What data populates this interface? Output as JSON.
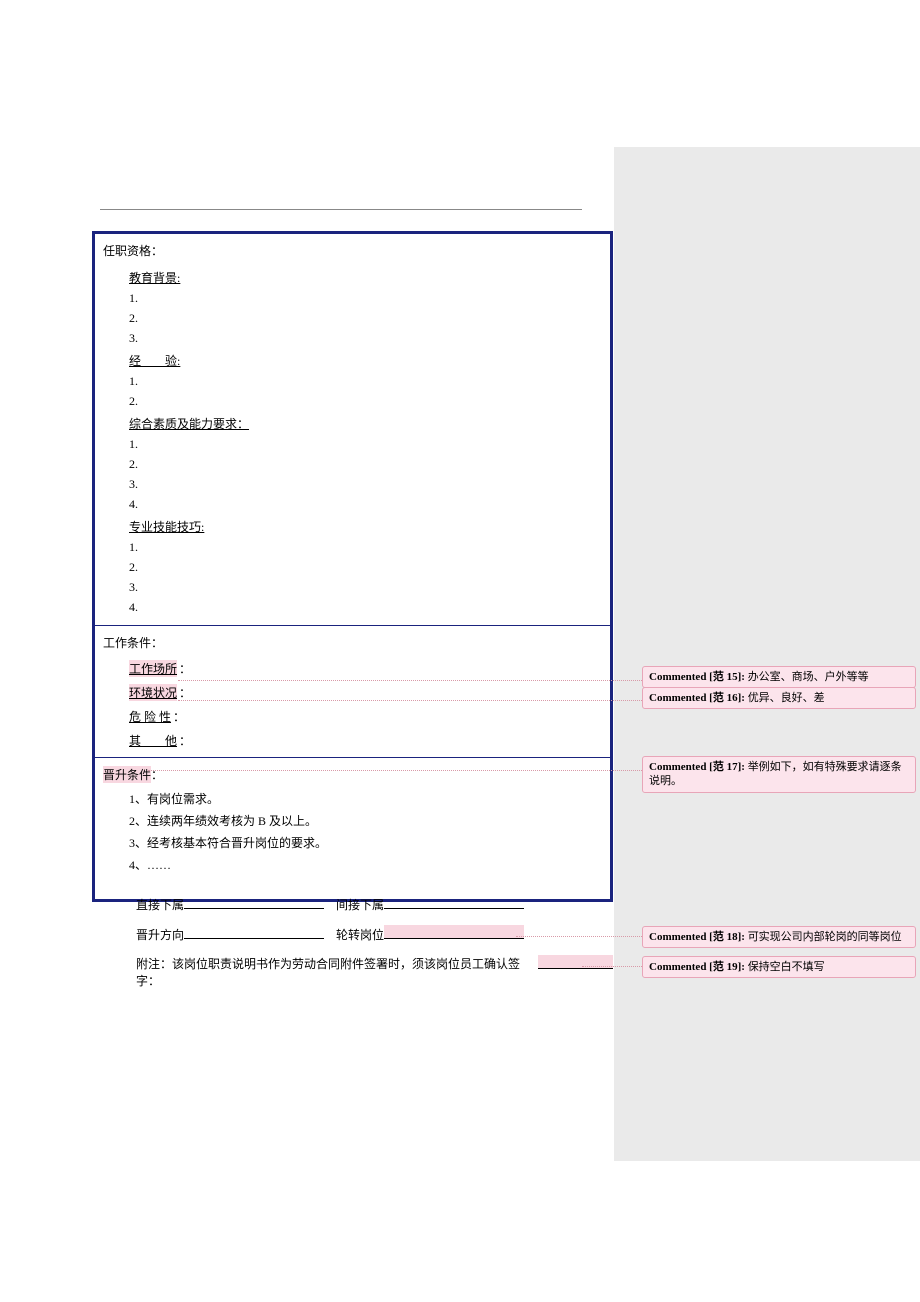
{
  "section1": {
    "title": "任职资格：",
    "edu_head": "教育背景:",
    "edu1": "1.",
    "edu2": "2.",
    "edu3": "3.",
    "exp_head": "经　　验:",
    "exp1": "1.",
    "exp2": "2.",
    "comp_head": "综合素质及能力要求： ",
    "comp1": "1.",
    "comp2": "2.",
    "comp3": "3.",
    "comp4": "4.",
    "skill_head": "专业技能技巧:",
    "skill1": "1.",
    "skill2": "2.",
    "skill3": "3.",
    "skill4": "4."
  },
  "section2": {
    "title": "工作条件：",
    "row1_label": "工作场所",
    "row1_colon": "：",
    "row2_label": "环境状况",
    "row2_colon": "：",
    "row3_label": "危 险 性",
    "row3_colon": "：",
    "row4_label": "其　　他",
    "row4_colon": "："
  },
  "section3": {
    "title": "晋升条件",
    "colon": "：",
    "item1": "1、有岗位需求。",
    "item2": "2、连续两年绩效考核为 B 及以上。",
    "item3": "3、经考核基本符合晋升岗位的要求。",
    "item4": "4、……"
  },
  "footer": {
    "row1_a": "直接下属",
    "row1_b": "间接下属",
    "row2_a": "晋升方向",
    "row2_b": "轮转岗位",
    "note_prefix": "附注：该岗位职责说明书作为劳动合同附件签署时，须该岗位员工确认签字："
  },
  "comments": {
    "c15_label": "Commented [范 15]:",
    "c15_text": "  办公室、商场、户外等等",
    "c16_label": "Commented [范 16]:",
    "c16_text": "  优异、良好、差",
    "c17_label": "Commented [范 17]:",
    "c17_text": "  举例如下，如有特殊要求请逐条说明。",
    "c18_label": "Commented [范 18]:",
    "c18_text": "  可实现公司内部轮岗的同等岗位",
    "c19_label": "Commented [范 19]:",
    "c19_text": "  保持空白不填写"
  }
}
